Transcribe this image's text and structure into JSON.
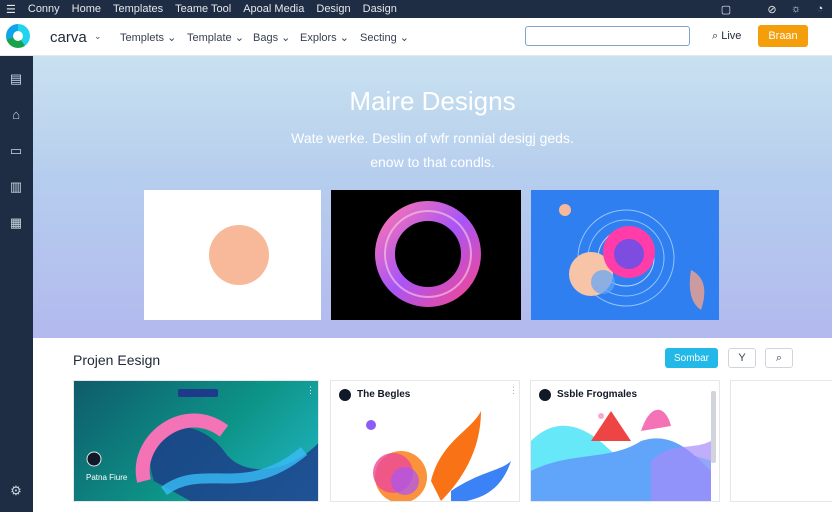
{
  "titlebar": {
    "menu": [
      "Conny",
      "Home",
      "Templates",
      "Teame Tool",
      "Apoal Media",
      "Design",
      "Dasign"
    ],
    "icons": [
      "hamburger-icon",
      "window-icon",
      "link-icon",
      "bell-icon"
    ]
  },
  "nav": {
    "brand": "carva",
    "items": [
      "Templets",
      "Template",
      "Bags",
      "Explors",
      "Secting"
    ],
    "search_placeholder": "",
    "live_label": "Live",
    "cta_label": "Braan"
  },
  "sidebar": {
    "icons": [
      "document-icon",
      "shape-icon",
      "folder-icon",
      "chart-icon",
      "apps-icon",
      "settings-icon"
    ]
  },
  "hero": {
    "title": "Maire Designs",
    "subtitle_line1": "Wate werke. Deslin of wfr ronnial desigj geds.",
    "subtitle_line2": "enow to that condls.",
    "colors": {
      "card1_bg": "#ffffff",
      "card1_circle": "#f7b99a",
      "card2_bg": "#000000",
      "card3_bg": "#2f7ff0"
    }
  },
  "projects": {
    "title": "Projen Eesign",
    "primary_button": "Sombar",
    "filter_glyph": "Y",
    "search_glyph": "⌕",
    "tiles": [
      {
        "label": "Patna Fiure"
      },
      {
        "label": "The Begles"
      },
      {
        "label": "Ssble Frogmales"
      }
    ]
  }
}
